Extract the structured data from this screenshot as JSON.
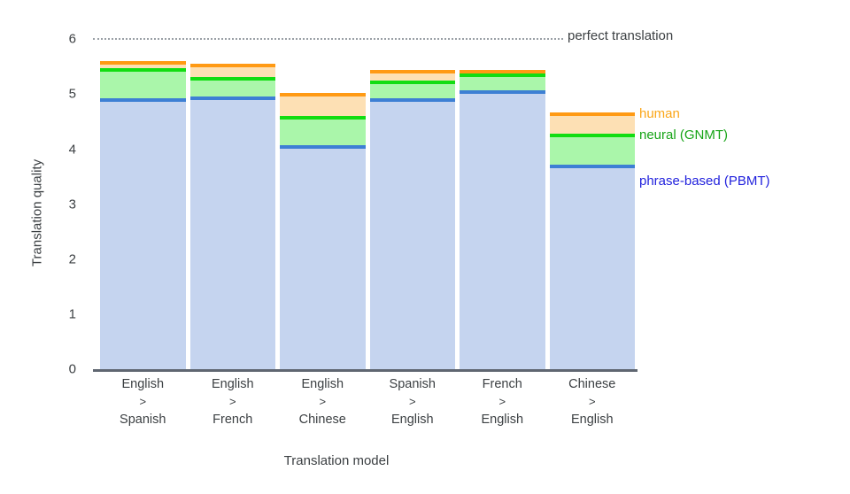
{
  "chart_data": {
    "type": "bar",
    "subtype": "layered-stacked-threshold",
    "title": "",
    "xlabel": "Translation model",
    "ylabel": "Translation quality",
    "ylim": [
      0,
      6
    ],
    "yticks": [
      0,
      1,
      2,
      3,
      4,
      5,
      6
    ],
    "grid": false,
    "legend_position": "right",
    "categories": [
      "English > Spanish",
      "English > French",
      "English > Chinese",
      "Spanish > English",
      "French > English",
      "Chinese > English"
    ],
    "category_lines": [
      [
        "English",
        ">",
        "Spanish"
      ],
      [
        "English",
        ">",
        "French"
      ],
      [
        "English",
        ">",
        "Chinese"
      ],
      [
        "Spanish",
        ">",
        "English"
      ],
      [
        "French",
        ">",
        "English"
      ],
      [
        "Chinese",
        ">",
        "English"
      ]
    ],
    "series": [
      {
        "name": "phrase-based (PBMT)",
        "key": "pbmt",
        "color": "#2222dd",
        "line_color": "#3d7fd4",
        "fill_color": "#c5d4ef",
        "values": [
          4.89,
          4.92,
          4.04,
          4.89,
          5.03,
          3.68
        ]
      },
      {
        "name": "neural (GNMT)",
        "key": "gnmt",
        "color": "#17a417",
        "line_color": "#12dd12",
        "fill_color": "#aaf6aa",
        "values": [
          5.43,
          5.27,
          4.57,
          5.22,
          5.34,
          4.25
        ]
      },
      {
        "name": "human",
        "key": "human",
        "color": "#fba618",
        "line_color": "#ff9a14",
        "fill_color": "#fde0b4",
        "values": [
          5.56,
          5.51,
          4.99,
          5.4,
          5.4,
          4.63
        ]
      }
    ],
    "annotations": [
      {
        "name": "perfect-translation",
        "label": "perfect translation",
        "value": 6,
        "style": "dotted",
        "color": "#9aa0a6"
      }
    ]
  },
  "legend": {
    "human_label": "human",
    "gnmt_label": "neural (GNMT)",
    "pbmt_label": "phrase-based (PBMT)"
  },
  "axes": {
    "y_title": "Translation quality",
    "x_title": "Translation model",
    "y_ticks": [
      "6",
      "5",
      "4",
      "3",
      "2",
      "1",
      "0"
    ]
  },
  "goal": {
    "label": "perfect translation"
  }
}
